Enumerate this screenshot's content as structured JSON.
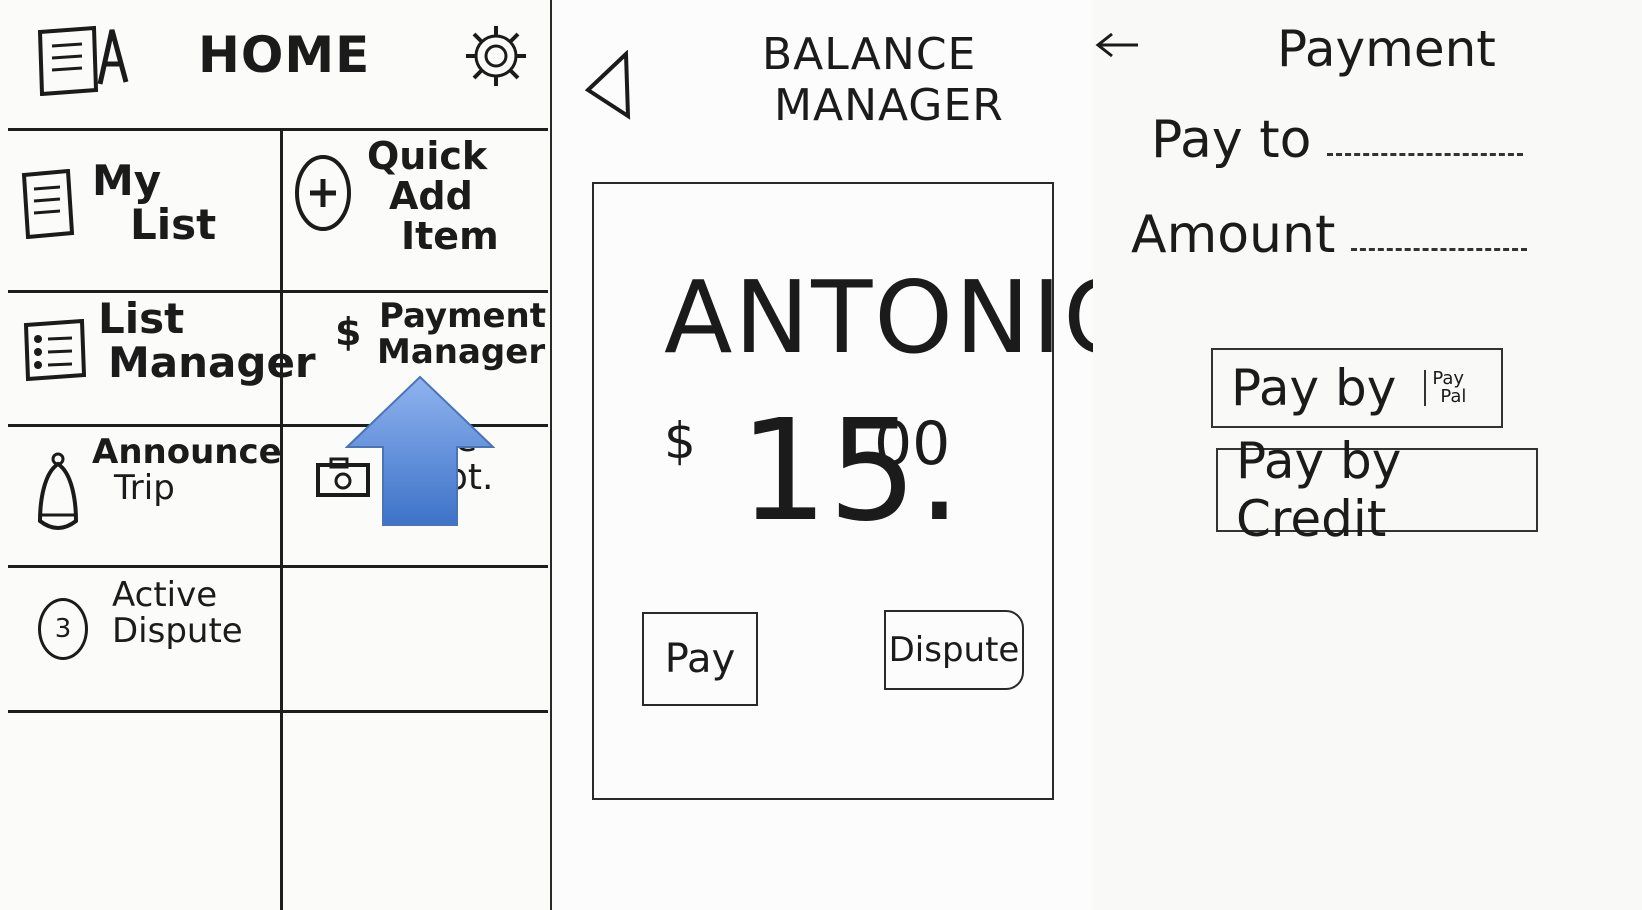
{
  "home": {
    "title": "HOME",
    "cells": {
      "my_list": [
        "My",
        "List"
      ],
      "quick_add": [
        "Quick",
        "Add",
        "Item"
      ],
      "list_manager": [
        "List",
        "Manager"
      ],
      "payment_manager": [
        "Payment",
        "Manager"
      ],
      "announce_trip": [
        "Announce",
        "Trip"
      ],
      "capture_receipt": [
        "re",
        "ipt."
      ],
      "active_dispute": [
        "Active",
        "Dispute"
      ]
    },
    "dispute_count": "3",
    "currency_symbol": "$",
    "plus_symbol": "+"
  },
  "balance": {
    "title_line1": "BALANCE",
    "title_line2": "MANAGER",
    "name": "ANTONIO",
    "currency": "$",
    "amount_whole": "15.",
    "amount_fraction": "00",
    "pay_label": "Pay",
    "dispute_label": "Dispute"
  },
  "payment": {
    "title": "Payment",
    "pay_to_label": "Pay to",
    "amount_label": "Amount",
    "paypal_button": "Pay by",
    "paypal_logo_top": "Pay",
    "paypal_logo_bottom": "Pal",
    "credit_button": "Pay by Credit"
  },
  "colors": {
    "arrow_fill": "#4f86d6",
    "ink": "#1b1b1b",
    "paper": "#fbfbfa"
  }
}
